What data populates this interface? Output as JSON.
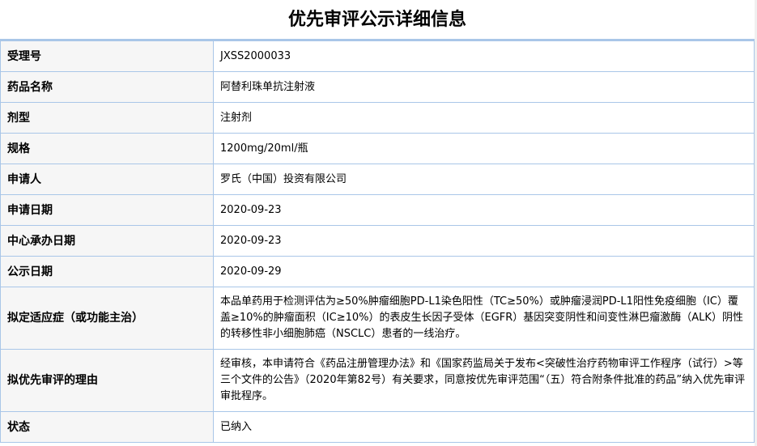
{
  "page": {
    "title": "优先审评公示详细信息"
  },
  "rows": [
    {
      "label": "受理号",
      "value": "JXSS2000033"
    },
    {
      "label": "药品名称",
      "value": "阿替利珠单抗注射液"
    },
    {
      "label": "剂型",
      "value": "注射剂"
    },
    {
      "label": "规格",
      "value": "1200mg/20ml/瓶"
    },
    {
      "label": "申请人",
      "value": "罗氏（中国）投资有限公司"
    },
    {
      "label": "申请日期",
      "value": "2020-09-23"
    },
    {
      "label": "中心承办日期",
      "value": "2020-09-23"
    },
    {
      "label": "公示日期",
      "value": "2020-09-29"
    },
    {
      "label": "拟定适应症（或功能主治）",
      "value": "本品单药用于检测评估为≥50%肿瘤细胞PD-L1染色阳性（TC≥50%）或肿瘤浸润PD-L1阳性免疫细胞（IC）覆盖≥10%的肿瘤面积（IC≥10%）的表皮生长因子受体（EGFR）基因突变阴性和间变性淋巴瘤激酶（ALK）阴性的转移性非小细胞肺癌（NSCLC）患者的一线治疗。"
    },
    {
      "label": "拟优先审评的理由",
      "value": "经审核，本申请符合《药品注册管理办法》和《国家药监局关于发布<突破性治疗药物审评工作程序（试行）>等三个文件的公告》（2020年第82号）有关要求，同意按优先审评范围“（五）符合附条件批准的药品”纳入优先审评审批程序。"
    },
    {
      "label": "状态",
      "value": "已纳入"
    }
  ]
}
